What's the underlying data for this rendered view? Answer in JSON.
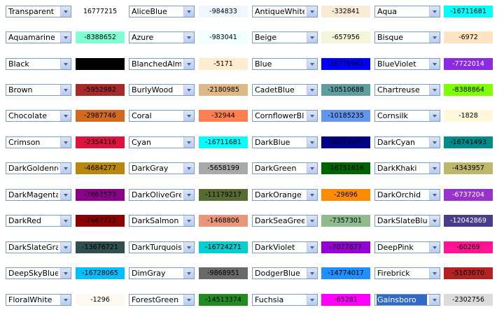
{
  "colors": [
    [
      [
        "Transparent",
        "#ffffff",
        "16777215",
        "#000000"
      ],
      [
        "AliceBlue",
        "#f0f8ff",
        "-984833",
        "#000000"
      ],
      [
        "AntiqueWhite",
        "#faebd7",
        "-332841",
        "#000000"
      ],
      [
        "Aqua",
        "#00ffff",
        "-16711681",
        "#000000"
      ]
    ],
    [
      [
        "Aquamarine",
        "#7fffd4",
        "-8388652",
        "#000000"
      ],
      [
        "Azure",
        "#f0ffff",
        "-983041",
        "#000000"
      ],
      [
        "Beige",
        "#f5f5dc",
        "-657956",
        "#000000"
      ],
      [
        "Bisque",
        "#ffe4c4",
        "-6972",
        "#000000"
      ]
    ],
    [
      [
        "Black",
        "#000000",
        "",
        "#000000"
      ],
      [
        "BlanchedAlmond",
        "#ffebcd",
        "-5171",
        "#000000"
      ],
      [
        "Blue",
        "#0000ff",
        "-16776961",
        "#000000"
      ],
      [
        "BlueViolet",
        "#8a2be2",
        "-7722014",
        "#ffffff"
      ]
    ],
    [
      [
        "Brown",
        "#a52a2a",
        "-5952982",
        "#000000"
      ],
      [
        "BurlyWood",
        "#deb887",
        "-2180985",
        "#000000"
      ],
      [
        "CadetBlue",
        "#5f9ea0",
        "-10510688",
        "#000000"
      ],
      [
        "Chartreuse",
        "#7fff00",
        "-8388864",
        "#000000"
      ]
    ],
    [
      [
        "Chocolate",
        "#d2691e",
        "-2987746",
        "#000000"
      ],
      [
        "Coral",
        "#ff7f50",
        "-32944",
        "#000000"
      ],
      [
        "CornflowerBlue",
        "#6495ed",
        "-10185235",
        "#000000"
      ],
      [
        "Cornsilk",
        "#fff8dc",
        "-1828",
        "#000000"
      ]
    ],
    [
      [
        "Crimson",
        "#dc143c",
        "-2354116",
        "#000000"
      ],
      [
        "Cyan",
        "#00ffff",
        "-16711681",
        "#000000"
      ],
      [
        "DarkBlue",
        "#00008b",
        "-16777077",
        "#000000"
      ],
      [
        "DarkCyan",
        "#008b8b",
        "-16741493",
        "#000000"
      ]
    ],
    [
      [
        "DarkGoldenrod",
        "#b8860b",
        "-4684277",
        "#000000"
      ],
      [
        "DarkGray",
        "#a9a9a9",
        "-5658199",
        "#000000"
      ],
      [
        "DarkGreen",
        "#006400",
        "-16751616",
        "#000000"
      ],
      [
        "DarkKhaki",
        "#bdb76b",
        "-4343957",
        "#000000"
      ]
    ],
    [
      [
        "DarkMagenta",
        "#8b008b",
        "-7667573",
        "#000000"
      ],
      [
        "DarkOliveGreen",
        "#556b2f",
        "-11179217",
        "#000000"
      ],
      [
        "DarkOrange",
        "#ff8c00",
        "-29696",
        "#000000"
      ],
      [
        "DarkOrchid",
        "#9932cc",
        "-6737204",
        "#ffffff"
      ]
    ],
    [
      [
        "DarkRed",
        "#8b0000",
        "-7667712",
        "#000000"
      ],
      [
        "DarkSalmon",
        "#e9967a",
        "-1468806",
        "#000000"
      ],
      [
        "DarkSeaGreen",
        "#8fbc8f",
        "-7357301",
        "#000000"
      ],
      [
        "DarkSlateBlue",
        "#483d8b",
        "-12042869",
        "#ffffff"
      ]
    ],
    [
      [
        "DarkSlateGray",
        "#2f4f4f",
        "-13676721",
        "#000000"
      ],
      [
        "DarkTurquoise",
        "#00ced1",
        "-16724271",
        "#000000"
      ],
      [
        "DarkViolet",
        "#9400d3",
        "-7077677",
        "#000000"
      ],
      [
        "DeepPink",
        "#ff1493",
        "-60269",
        "#000000"
      ]
    ],
    [
      [
        "DeepSkyBlue",
        "#00bfff",
        "-16728065",
        "#000000"
      ],
      [
        "DimGray",
        "#696969",
        "-9868951",
        "#000000"
      ],
      [
        "DodgerBlue",
        "#1e90ff",
        "-14774017",
        "#000000"
      ],
      [
        "Firebrick",
        "#b22222",
        "-5103070",
        "#000000"
      ]
    ],
    [
      [
        "FloralWhite",
        "#fffaf0",
        "-1296",
        "#000000"
      ],
      [
        "ForestGreen",
        "#228b22",
        "-14513374",
        "#000000"
      ],
      [
        "Fuchsia",
        "#ff00ff",
        "-65281",
        "#000000"
      ],
      [
        "Gainsboro",
        "#dcdcdc",
        "-2302756",
        "#000000"
      ]
    ]
  ],
  "combo_display": [
    [
      "Transparent",
      "AliceBlue",
      "AntiqueWhite",
      "Aqua"
    ],
    [
      "Aquamarine",
      "Azure",
      "Beige",
      "Bisque"
    ],
    [
      "Black",
      "BlanchedAlmor",
      "Blue",
      "BlueViolet"
    ],
    [
      "Brown",
      "BurlyWood",
      "CadetBlue",
      "Chartreuse"
    ],
    [
      "Chocolate",
      "Coral",
      "CornflowerBlue",
      "Cornsilk"
    ],
    [
      "Crimson",
      "Cyan",
      "DarkBlue",
      "DarkCyan"
    ],
    [
      "DarkGoldenrod",
      "DarkGray",
      "DarkGreen",
      "DarkKhaki"
    ],
    [
      "DarkMagenta",
      "DarkOliveGreen",
      "DarkOrange",
      "DarkOrchid"
    ],
    [
      "DarkRed",
      "DarkSalmon",
      "DarkSeaGreen",
      "DarkSlateBlue"
    ],
    [
      "DarkSlateGray",
      "DarkTurquoise",
      "DarkViolet",
      "DeepPink"
    ],
    [
      "DeepSkyBlue",
      "DimGray",
      "DodgerBlue",
      "Firebrick"
    ],
    [
      "FloralWhite",
      "ForestGreen",
      "Fuchsia",
      "Gainsboro"
    ]
  ],
  "selected": "Gainsboro",
  "icons": {
    "dropdown": "chevron-down-icon"
  }
}
